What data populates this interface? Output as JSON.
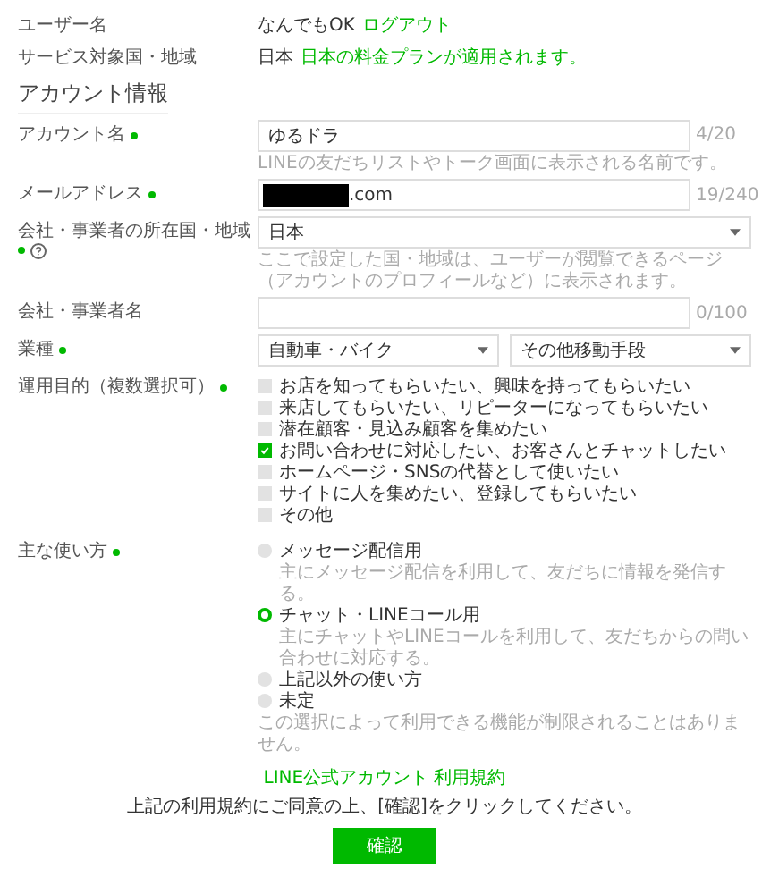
{
  "user": {
    "label": "ユーザー名",
    "value": "なんでもOK",
    "logout_link": "ログアウト"
  },
  "service_region": {
    "label": "サービス対象国・地域",
    "value": "日本",
    "note": "日本の料金プランが適用されます。"
  },
  "section_title": "アカウント情報",
  "account_name": {
    "label": "アカウント名",
    "required": true,
    "value": "ゆるドラ",
    "counter": "4/20",
    "hint": "LINEの友だちリストやトーク画面に表示される名前です。"
  },
  "email": {
    "label": "メールアドレス",
    "required": true,
    "value": ".com",
    "counter": "19/240"
  },
  "company_country": {
    "label": "会社・事業者の所在国・地域",
    "required": true,
    "value": "日本",
    "hint": "ここで設定した国・地域は、ユーザーが閲覧できるページ（アカウントのプロフィールなど）に表示されます。"
  },
  "company_name": {
    "label": "会社・事業者名",
    "counter": "0/100"
  },
  "industry": {
    "label": "業種",
    "required": true,
    "values": [
      "自動車・バイク",
      "その他移動手段"
    ]
  },
  "purposes": {
    "label": "運用目的（複数選択可）",
    "required": true,
    "options": [
      {
        "label": "お店を知ってもらいたい、興味を持ってもらいたい",
        "checked": false
      },
      {
        "label": "来店してもらいたい、リピーターになってもらいたい",
        "checked": false
      },
      {
        "label": "潜在顧客・見込み顧客を集めたい",
        "checked": false
      },
      {
        "label": "お問い合わせに対応したい、お客さんとチャットしたい",
        "checked": true
      },
      {
        "label": "ホームページ・SNSの代替として使いたい",
        "checked": false
      },
      {
        "label": "サイトに人を集めたい、登録してもらいたい",
        "checked": false
      },
      {
        "label": "その他",
        "checked": false
      }
    ]
  },
  "usage": {
    "label": "主な使い方",
    "required": true,
    "options": [
      {
        "label": "メッセージ配信用",
        "hint": "主にメッセージ配信を利用して、友だちに情報を発信する。",
        "selected": false
      },
      {
        "label": "チャット・LINEコール用",
        "hint": "主にチャットやLINEコールを利用して、友だちからの問い合わせに対応する。",
        "selected": true
      },
      {
        "label": "上記以外の使い方",
        "selected": false
      },
      {
        "label": "未定",
        "selected": false
      }
    ],
    "note": "この選択によって利用できる機能が制限されることはありません。"
  },
  "terms_link": "LINE公式アカウント 利用規約",
  "agreement": "上記の利用規約にご同意の上、[確認]をクリックしてください。",
  "confirm_button": "確認"
}
